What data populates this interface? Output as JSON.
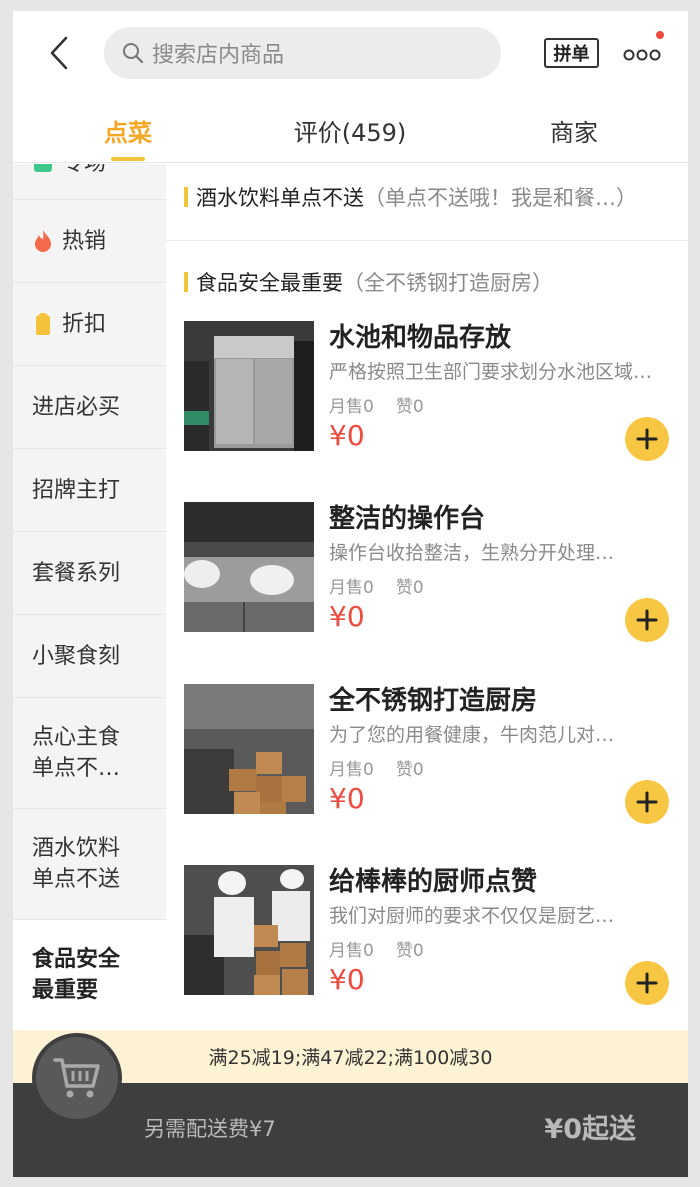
{
  "header": {
    "search_placeholder": "搜索店内商品",
    "pindan_label": "拼单"
  },
  "tabs": [
    {
      "label": "点菜",
      "active": true
    },
    {
      "label": "评价(459)",
      "active": false
    },
    {
      "label": "商家",
      "active": false
    }
  ],
  "sidebar": {
    "items": [
      {
        "label": "专场",
        "icon": "tag-icon"
      },
      {
        "label": "热销",
        "icon": "flame-icon"
      },
      {
        "label": "折扣",
        "icon": "discount-tag-icon"
      },
      {
        "label": "进店必买"
      },
      {
        "label": "招牌主打"
      },
      {
        "label": "套餐系列"
      },
      {
        "label": "小聚食刻"
      },
      {
        "label": "点心主食单点不…"
      },
      {
        "label": "酒水饮料单点不送"
      },
      {
        "label": "食品安全最重要",
        "active": true
      }
    ]
  },
  "content": {
    "category_1": {
      "title": "酒水饮料单点不送",
      "subtitle": "（单点不送哦！我是和餐…）"
    },
    "category_2": {
      "title": "食品安全最重要",
      "subtitle": "（全不锈钢打造厨房）"
    },
    "dishes": [
      {
        "name": "水池和物品存放",
        "desc": "严格按照卫生部门要求划分水池区域…",
        "monthly_sales": "月售0",
        "likes": "赞0",
        "price": "¥0"
      },
      {
        "name": "整洁的操作台",
        "desc": "操作台收拾整洁，生熟分开处理…",
        "monthly_sales": "月售0",
        "likes": "赞0",
        "price": "¥0"
      },
      {
        "name": "全不锈钢打造厨房",
        "desc": "为了您的用餐健康，牛肉范儿对…",
        "monthly_sales": "月售0",
        "likes": "赞0",
        "price": "¥0"
      },
      {
        "name": "给棒棒的厨师点赞",
        "desc": "我们对厨师的要求不仅仅是厨艺…",
        "monthly_sales": "月售0",
        "likes": "赞0",
        "price": "¥0"
      }
    ]
  },
  "promo": {
    "text": "满25减19;满47减22;满100减30"
  },
  "bottom_bar": {
    "delivery_fee": "另需配送费¥7",
    "min_order": "¥0起送"
  },
  "colors": {
    "accent": "#f5c33b",
    "price": "#ef4b3f",
    "active_tab": "#f5a623"
  }
}
